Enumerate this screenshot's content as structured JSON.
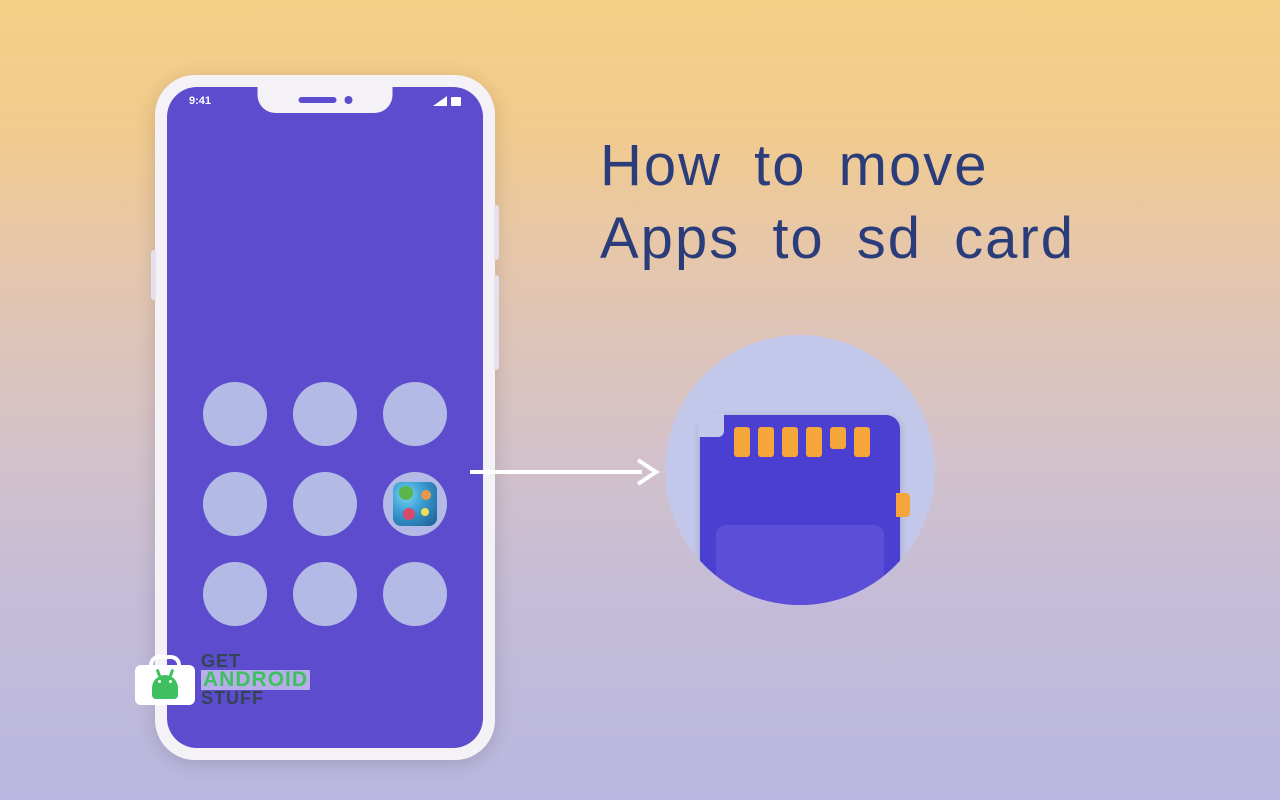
{
  "title": {
    "line1": "How to move",
    "line2": "Apps to sd card"
  },
  "phone": {
    "status_time": "9:41"
  },
  "watermark": {
    "line1": "GET",
    "line2": "ANDROID",
    "line3": "STUFF"
  }
}
